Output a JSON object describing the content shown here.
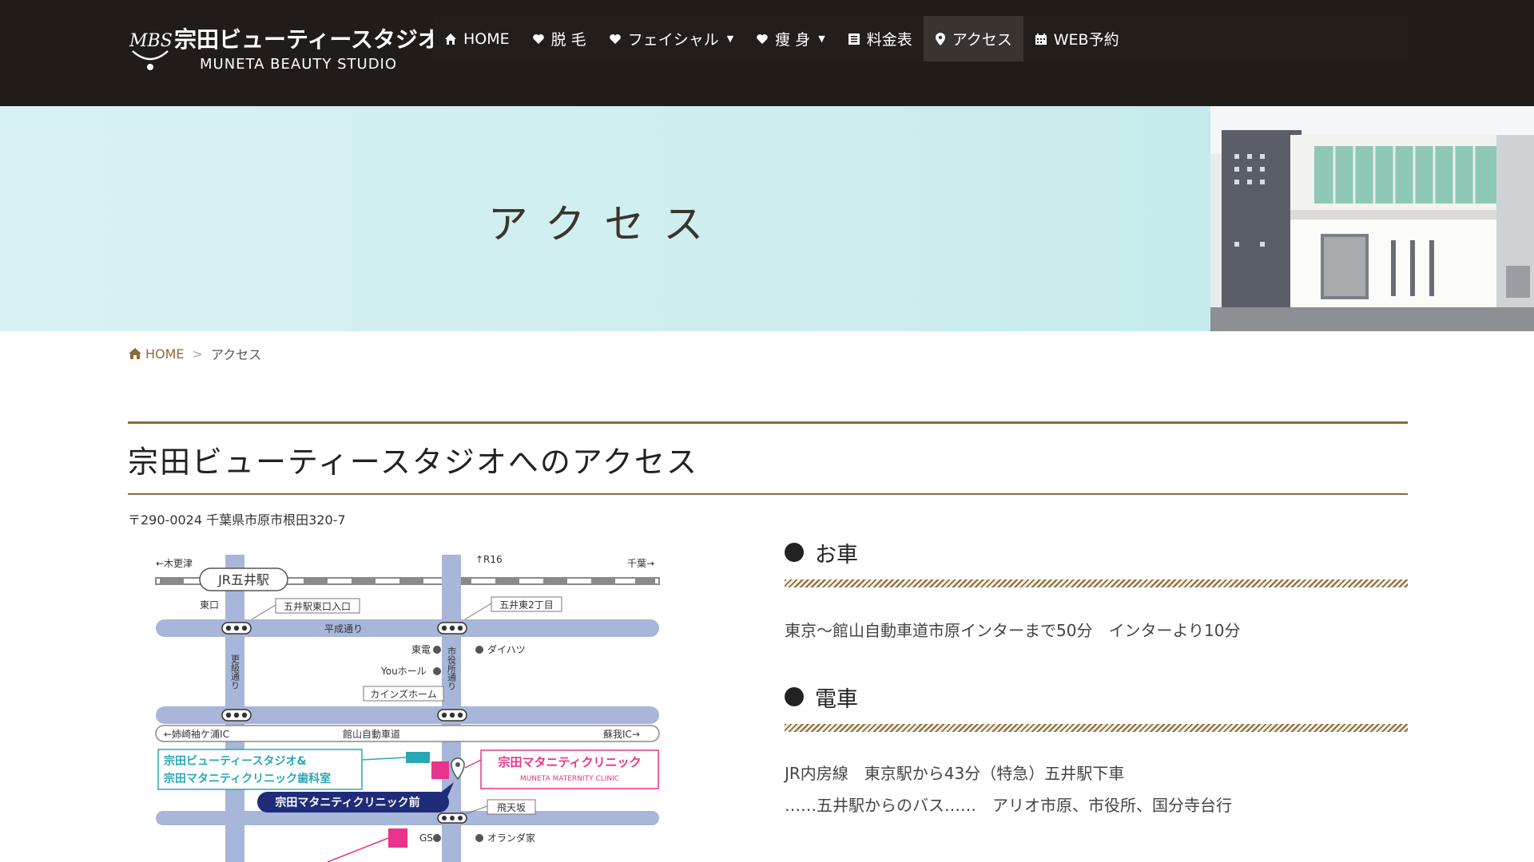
{
  "header": {
    "logo_mbs": "MBS",
    "logo_jp": "宗田ビューティースタジオ",
    "logo_en": "MUNETA BEAUTY STUDIO",
    "nav": [
      {
        "label": "HOME",
        "icon": "home-icon"
      },
      {
        "label": "脱 毛",
        "icon": "heart-icon"
      },
      {
        "label": "フェイシャル",
        "icon": "heart-icon",
        "caret": "▼"
      },
      {
        "label": "痩 身",
        "icon": "heart-icon",
        "caret": "▼"
      },
      {
        "label": "料金表",
        "icon": "list-icon"
      },
      {
        "label": "アクセス",
        "icon": "map-pin-icon",
        "active": true
      },
      {
        "label": "WEB予約",
        "icon": "calendar-icon"
      }
    ]
  },
  "hero": {
    "title": "アクセス"
  },
  "breadcrumb": {
    "home": "HOME",
    "separator": ">",
    "current": "アクセス"
  },
  "section": {
    "title": "宗田ビューティースタジオへのアクセス",
    "address": "〒290-0024 千葉県市原市根田320-7"
  },
  "map": {
    "to_kisarazu": "←木更津",
    "station": "JR五井駅",
    "r16": "↑R16",
    "to_chiba": "千葉→",
    "east_exit": "東口",
    "goi_east_entrance": "五井駅東口入口",
    "goi_east_2": "五井東2丁目",
    "heisei_dori": "平成通り",
    "toden": "東電",
    "daihatsu": "ダイハツ",
    "you_hall": "Youホール",
    "cainz_home": "カインズホーム",
    "kamaba_dori": "更級通り",
    "shiyakusho_dori": "市役所通り",
    "to_anesaki": "←姉崎袖ケ浦IC",
    "tateyama_expressway": "館山自動車道",
    "to_soga": "蘇我IC→",
    "studio_label_1": "宗田ビューティースタジオ&",
    "studio_label_2": "宗田マタニティクリニック歯科室",
    "clinic_name": "宗田マタニティクリニック",
    "clinic_en": "MUNETA MATERNITY CLINIC",
    "bus_stop": "宗田マタニティクリニック前",
    "hitenzaka": "飛天坂",
    "gs": "GS",
    "oranda": "オランダ家"
  },
  "car": {
    "heading": "お車",
    "text": "東京～館山自動車道市原インターまで50分　インターより10分"
  },
  "train": {
    "heading": "電車",
    "line1": "JR内房線　東京駅から43分（特急）五井駅下車",
    "line2": "……五井駅からのバス……　アリオ市原、市役所、国分寺台行"
  },
  "colors": {
    "header_bg": "#221c18",
    "accent": "#8a6b3a",
    "hero_bg": "#cdeeee",
    "map_road": "#a7b6d9",
    "clinic_pink": "#e8348c",
    "studio_teal": "#29a8b4",
    "bus_navy": "#1f2c7a"
  }
}
